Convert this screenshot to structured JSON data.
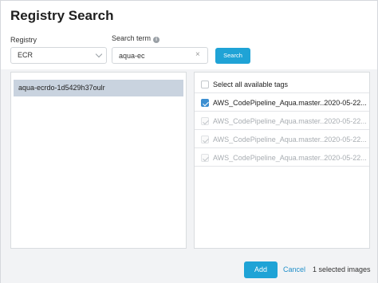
{
  "dialog": {
    "title": "Registry Search"
  },
  "form": {
    "registry_label": "Registry",
    "registry_value": "ECR",
    "search_term_label": "Search term",
    "search_term_value": "aqua-ec",
    "clear_symbol": "×",
    "search_button": "Search",
    "info_symbol": "i"
  },
  "repositories": [
    {
      "name": "aqua-ecrdo-1d5429h37oulr",
      "selected": true
    }
  ],
  "tags": {
    "select_all_label": "Select all available tags",
    "items": [
      {
        "label": "AWS_CodePipeline_Aqua.master..2020-05-22...",
        "checked": true,
        "disabled": false
      },
      {
        "label": "AWS_CodePipeline_Aqua.master..2020-05-22...",
        "checked": true,
        "disabled": true
      },
      {
        "label": "AWS_CodePipeline_Aqua.master..2020-05-22...",
        "checked": true,
        "disabled": true
      },
      {
        "label": "AWS_CodePipeline_Aqua.master..2020-05-22...",
        "checked": true,
        "disabled": true
      }
    ]
  },
  "footer": {
    "add_button": "Add",
    "cancel_link": "Cancel",
    "selected_count": "1 selected images"
  },
  "colors": {
    "accent": "#1fa3d6",
    "selected_row": "#c9d3df",
    "checkbox_checked": "#3c8fd1"
  }
}
